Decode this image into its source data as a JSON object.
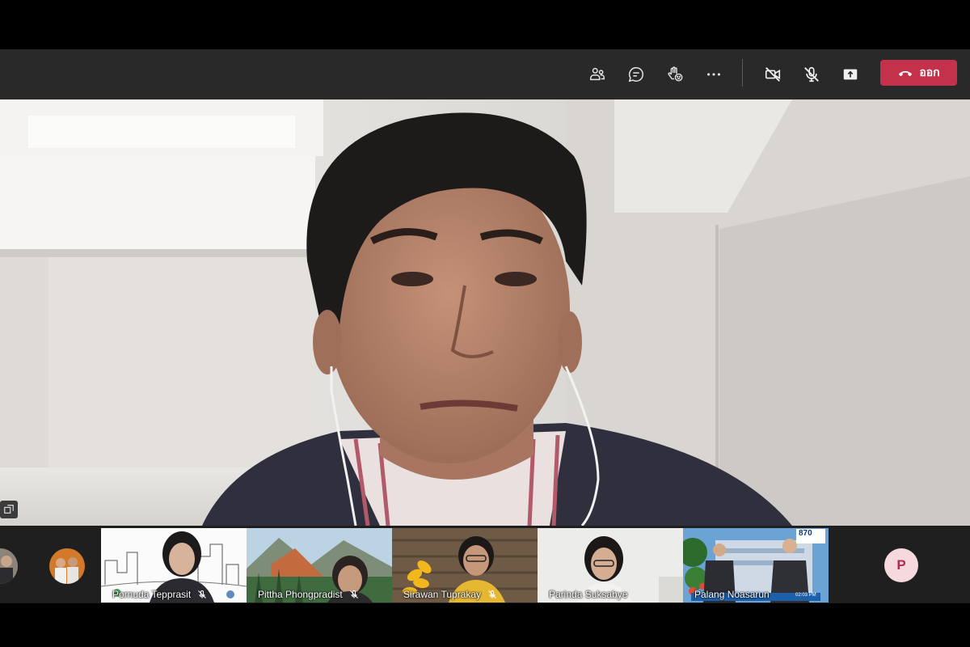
{
  "toolbar": {
    "icons": [
      "participants-icon",
      "chat-icon",
      "reactions-icon",
      "more-icon",
      "camera-off-icon",
      "mic-off-icon",
      "share-icon"
    ],
    "leave_label": "ออก",
    "leave_color": "#c4314b",
    "background": "#292929"
  },
  "gallery": {
    "tiles": [
      {
        "name": "Pornuda Tepprasit",
        "muted": true
      },
      {
        "name": "Pittha Phongpradist",
        "muted": true
      },
      {
        "name": "Sirawan Tuprakay",
        "muted": true
      },
      {
        "name": "Parinda Suksabye",
        "muted": false
      },
      {
        "name": "Palang Noasarun",
        "muted": false
      }
    ],
    "overflow_avatar_initial": "P",
    "broadcast_text": "870",
    "broadcast_time": "02:03 PM"
  }
}
